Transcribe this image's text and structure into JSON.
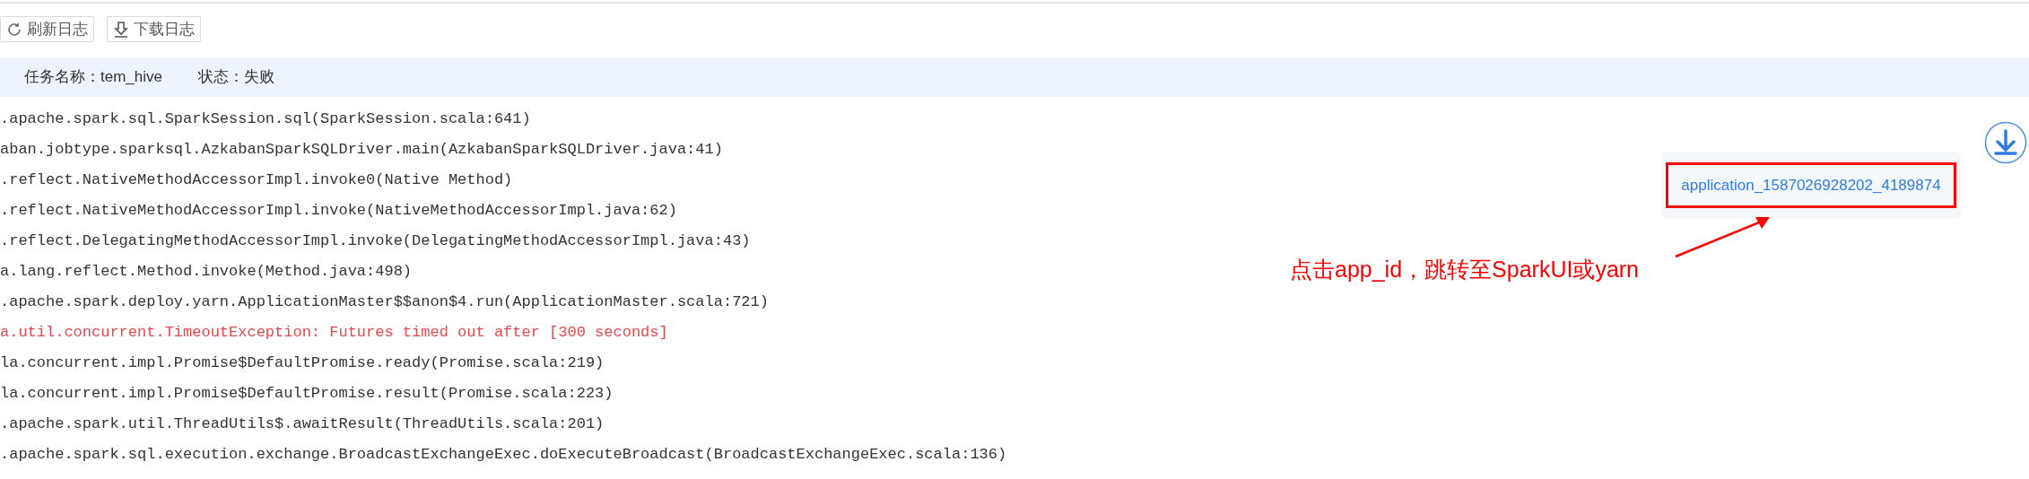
{
  "toolbar": {
    "buttons": [
      {
        "label": "刷新日志",
        "kind": "refresh"
      },
      {
        "label": "下载日志",
        "kind": "download"
      }
    ]
  },
  "task_info": {
    "name": "任务名称：tem_hive",
    "state": "状态：失败"
  },
  "log_lines": [
    {
      "text": ".apache.spark.sql.SparkSession.sql(SparkSession.scala:641)",
      "kind": "stack"
    },
    {
      "text": "aban.jobtype.sparksql.AzkabanSparkSQLDriver.main(AzkabanSparkSQLDriver.java:41)",
      "kind": "stack"
    },
    {
      "text": ".reflect.NativeMethodAccessorImpl.invoke0(Native Method)",
      "kind": "stack"
    },
    {
      "text": ".reflect.NativeMethodAccessorImpl.invoke(NativeMethodAccessorImpl.java:62)",
      "kind": "stack"
    },
    {
      "text": ".reflect.DelegatingMethodAccessorImpl.invoke(DelegatingMethodAccessorImpl.java:43)",
      "kind": "stack"
    },
    {
      "text": "a.lang.reflect.Method.invoke(Method.java:498)",
      "kind": "stack"
    },
    {
      "text": ".apache.spark.deploy.yarn.ApplicationMaster$$anon$4.run(ApplicationMaster.scala:721)",
      "kind": "stack"
    },
    {
      "text": "a.util.concurrent.TimeoutException: Futures timed out after [300 seconds]",
      "kind": "error"
    },
    {
      "text": "la.concurrent.impl.Promise$DefaultPromise.ready(Promise.scala:219)",
      "kind": "stack"
    },
    {
      "text": "la.concurrent.impl.Promise$DefaultPromise.result(Promise.scala:223)",
      "kind": "stack"
    },
    {
      "text": ".apache.spark.util.ThreadUtils$.awaitResult(ThreadUtils.scala:201)",
      "kind": "stack"
    },
    {
      "text": ".apache.spark.sql.execution.exchange.BroadcastExchangeExec.doExecuteBroadcast(BroadcastExchangeExec.scala:136)",
      "kind": "stack"
    }
  ],
  "app_link": "application_1587026928202_4189874",
  "annotation": "点击app_id，跳转至SparkUI或yarn"
}
